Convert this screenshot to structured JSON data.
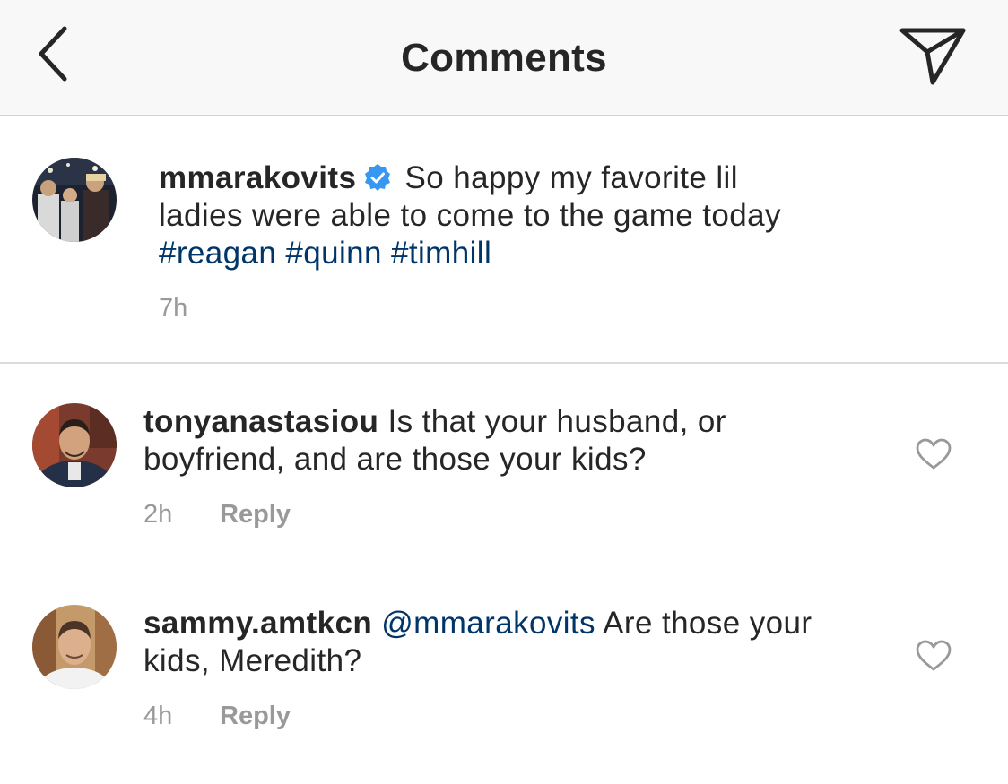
{
  "header": {
    "title": "Comments"
  },
  "caption": {
    "username": "mmarakovits",
    "text_line1": "So happy my favorite lil",
    "text_line2": "ladies were able to come to the game today",
    "hashtags": [
      "#reagan",
      "#quinn",
      "#timhill"
    ],
    "time": "7h"
  },
  "comments": [
    {
      "username": "tonyanastasiou",
      "text_line1": "Is that your husband, or",
      "text_line2": "boyfriend, and are those your kids?",
      "time": "2h",
      "reply_label": "Reply"
    },
    {
      "username": "sammy.amtkcn",
      "mention": "@mmarakovits",
      "text_line1": "Are those your",
      "text_line2": "kids, Meredith?",
      "time": "4h",
      "reply_label": "Reply"
    }
  ],
  "icons": {
    "back": "chevron-left-icon",
    "share": "paper-plane-icon",
    "verified": "verified-badge-icon",
    "like": "heart-outline-icon"
  },
  "colors": {
    "header_bg": "#f8f8f8",
    "text": "#262626",
    "hashtag": "#003569",
    "verified": "#3897f0",
    "muted": "#999999"
  }
}
